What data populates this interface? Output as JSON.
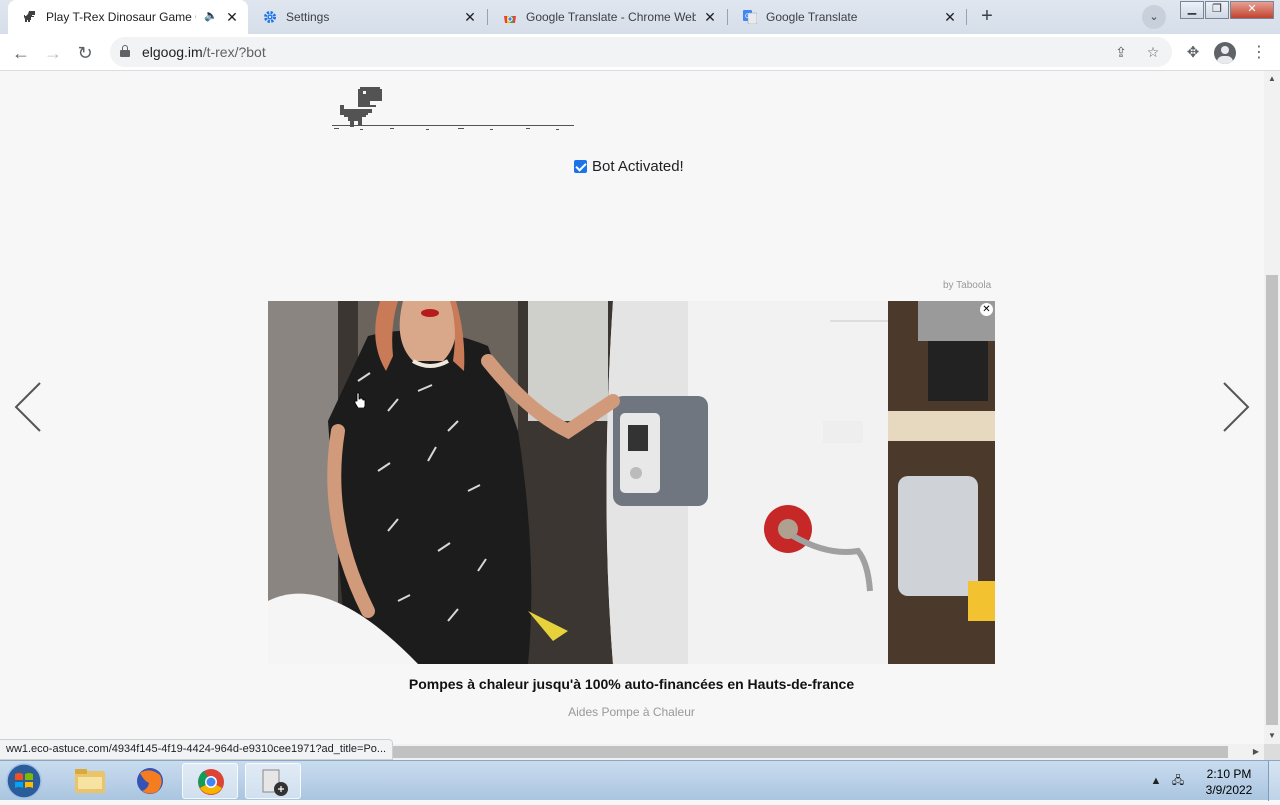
{
  "browser": {
    "tabs": [
      {
        "title": "Play T-Rex Dinosaur Game O",
        "icon": "dino-icon",
        "active": true,
        "audio": true
      },
      {
        "title": "Settings",
        "icon": "gear-icon",
        "active": false
      },
      {
        "title": "Google Translate - Chrome Web",
        "icon": "chrome-web-store-icon",
        "active": false
      },
      {
        "title": "Google Translate",
        "icon": "google-translate-icon",
        "active": false
      }
    ],
    "new_tab_symbol": "+",
    "url_host": "elgoog.im",
    "url_path": "/t-rex/?bot",
    "status_url": "ww1.eco-astuce.com/4934f145-4f19-4424-964d-e9310cee1971?ad_title=Po..."
  },
  "page": {
    "bot_checkbox_checked": true,
    "bot_label": "Bot Activated!",
    "ad": {
      "attribution": "by Taboola",
      "close_symbol": "✕",
      "title": "Pompes à chaleur jusqu'à 100% auto-financées en Hauts-de-france",
      "source": "Aides Pompe à Chaleur"
    }
  },
  "taskbar": {
    "time": "2:10 PM",
    "date": "3/9/2022",
    "apps": [
      "windows-explorer",
      "firefox",
      "chrome",
      "media-app"
    ]
  },
  "colors": {
    "accent": "#1a73e8",
    "page_background": "#f7f7f7",
    "dino": "#535353"
  }
}
